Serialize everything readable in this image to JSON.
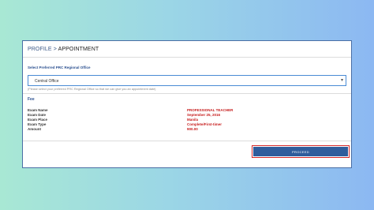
{
  "breadcrumb": {
    "parent": "PROFILE",
    "separator": " > ",
    "current": "APPOINTMENT"
  },
  "office": {
    "label": "Select Preferred PRC Regional Office",
    "selected": "Central Office",
    "help": "(Please select your preferred PRC Regional Office so that we can give you an appointment date)"
  },
  "fee": {
    "label": "Fee",
    "rows": [
      {
        "key": "Exam Name",
        "value": "PROFESSIONAL TEACHER"
      },
      {
        "key": "Exam Date",
        "value": "September 25, 2016"
      },
      {
        "key": "Exam Place",
        "value": "Manila"
      },
      {
        "key": "Exam Type",
        "value": "Complete/First-timer"
      },
      {
        "key": "Amount",
        "value": "900.00"
      }
    ]
  },
  "actions": {
    "proceed_label": "PROCEED"
  },
  "colors": {
    "accent": "#2f5d9c",
    "highlight": "#d42828",
    "value_text": "#c61a1a"
  },
  "icons": {
    "select_caret": "chevron-down-icon"
  }
}
